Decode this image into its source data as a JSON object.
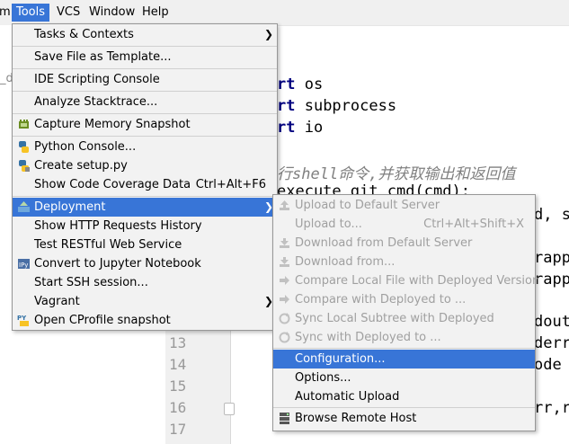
{
  "menubar": {
    "items": [
      "m",
      "Tools",
      "VCS",
      "Window",
      "Help"
    ]
  },
  "editor": {
    "file_tab_fragment": "_d",
    "code_lines": {
      "l1_kw": "rt",
      "l1_rest": " os",
      "l2_kw": "rt",
      "l2_rest": " subprocess",
      "l3_kw": "rt",
      "l3_rest": " io",
      "comment": "行shell命令,并获取输出和返回值",
      "def_line": "execute_git_cmd(cmd):",
      "frag1": "d, s",
      "frag2": "rapp",
      "frag3": "rapp",
      "frag4": "dout",
      "frag5": "derr",
      "frag6": "ode",
      "frag7": "rr,r"
    },
    "line_numbers": [
      "13",
      "14",
      "15",
      "16",
      "17"
    ]
  },
  "tools_menu": {
    "items": [
      {
        "label": "Tasks & Contexts",
        "submenu": true
      },
      {
        "label": "Save File as Template..."
      },
      {
        "label": "IDE Scripting Console"
      },
      {
        "label": "Analyze Stacktrace..."
      },
      {
        "label": "Capture Memory Snapshot",
        "icon": "memory-snapshot-icon"
      },
      {
        "label": "Python Console...",
        "icon": "python-icon"
      },
      {
        "label": "Create setup.py",
        "icon": "python-setup-icon"
      },
      {
        "label": "Show Code Coverage Data",
        "shortcut": "Ctrl+Alt+F6"
      },
      {
        "label": "Deployment",
        "icon": "deployment-icon",
        "submenu": true,
        "selected": true
      },
      {
        "label": "Show HTTP Requests History"
      },
      {
        "label": "Test RESTful Web Service"
      },
      {
        "label": "Convert to Jupyter Notebook",
        "icon": "jupyter-icon"
      },
      {
        "label": "Start SSH session..."
      },
      {
        "label": "Vagrant",
        "submenu": true
      },
      {
        "label": "Open CProfile snapshot",
        "icon": "cprofile-icon"
      }
    ]
  },
  "deployment_menu": {
    "items": [
      {
        "label": "Upload to Default Server",
        "disabled": true
      },
      {
        "label": "Upload to...",
        "shortcut": "Ctrl+Alt+Shift+X",
        "disabled": true
      },
      {
        "label": "Download from Default Server",
        "disabled": true
      },
      {
        "label": "Download from...",
        "disabled": true
      },
      {
        "label": "Compare Local File with Deployed Version",
        "disabled": true
      },
      {
        "label": "Compare with Deployed to ...",
        "disabled": true
      },
      {
        "label": "Sync Local Subtree with Deployed",
        "disabled": true
      },
      {
        "label": "Sync with Deployed to ...",
        "disabled": true
      },
      {
        "label": "Configuration...",
        "selected": true
      },
      {
        "label": "Options..."
      },
      {
        "label": "Automatic Upload"
      },
      {
        "label": "Browse Remote Host",
        "icon": "remote-host-icon"
      }
    ]
  },
  "colors": {
    "selection": "#3875d7",
    "menu_bg": "#f2f2f2",
    "keyword": "#000080",
    "comment": "#808080",
    "disabled_text": "#a0a0a0"
  }
}
